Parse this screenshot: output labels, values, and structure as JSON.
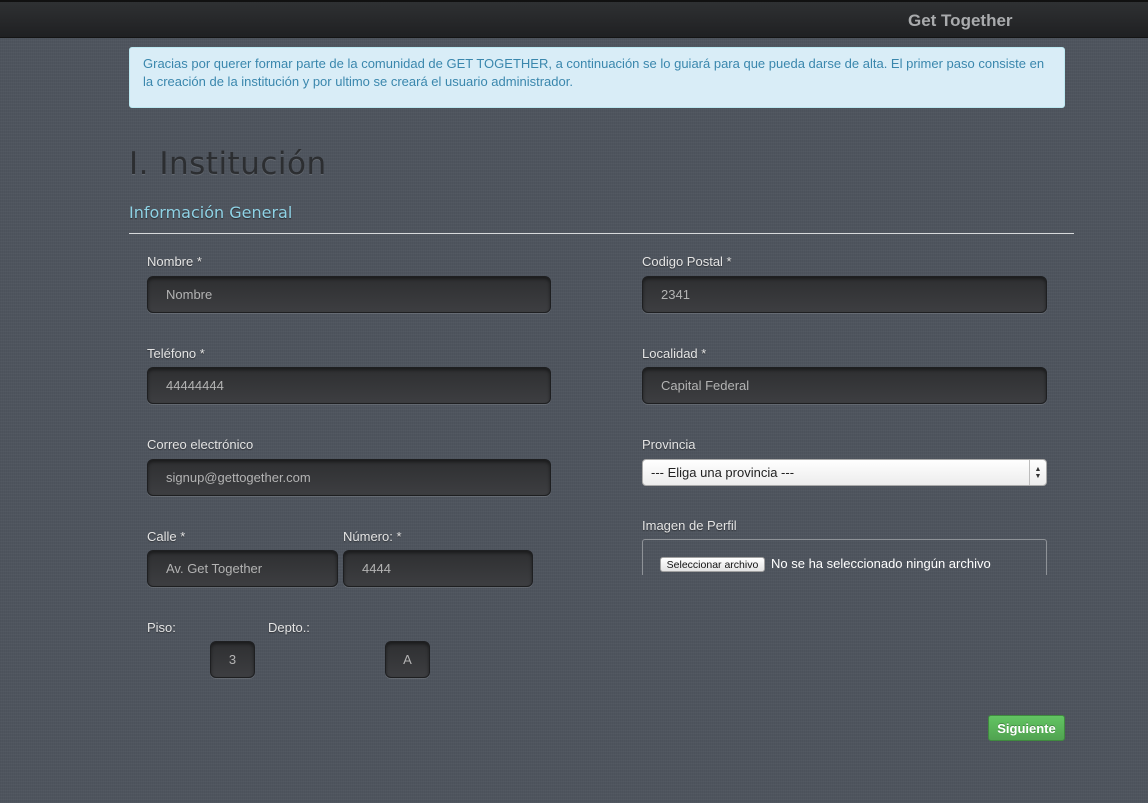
{
  "header": {
    "brand": "Get Together"
  },
  "alert": {
    "text": "Gracias por querer formar parte de la comunidad de GET TOGETHER, a continuación se lo guiará para que pueda darse de alta. El primer paso consiste en la creación de la institución y por ultimo se creará el usuario administrador."
  },
  "page": {
    "title": "I. Institución",
    "section": "Información General"
  },
  "form": {
    "nombre": {
      "label": "Nombre *",
      "placeholder": "Nombre"
    },
    "telefono": {
      "label": "Teléfono *",
      "value": "44444444"
    },
    "correo": {
      "label": "Correo electrónico",
      "value": "signup@gettogether.com"
    },
    "calle": {
      "label": "Calle *",
      "value": "Av. Get Together"
    },
    "numero": {
      "label": "Número: *",
      "value": "4444"
    },
    "piso": {
      "label": "Piso:",
      "value": "3"
    },
    "depto": {
      "label": "Depto.:",
      "value": "A"
    },
    "codigo_postal": {
      "label": "Codigo Postal *",
      "value": "2341"
    },
    "localidad": {
      "label": "Localidad *",
      "value": "Capital Federal"
    },
    "provincia": {
      "label": "Provincia",
      "selected": "--- Eliga una provincia ---"
    },
    "imagen": {
      "label": "Imagen de Perfil",
      "button": "Seleccionar archivo",
      "status": "No se ha seleccionado ningún archivo"
    }
  },
  "actions": {
    "next": "Siguiente"
  },
  "colors": {
    "accent_success": "#5bb75b",
    "info_text": "#3a87ad",
    "section_heading": "#8fd3e6"
  }
}
